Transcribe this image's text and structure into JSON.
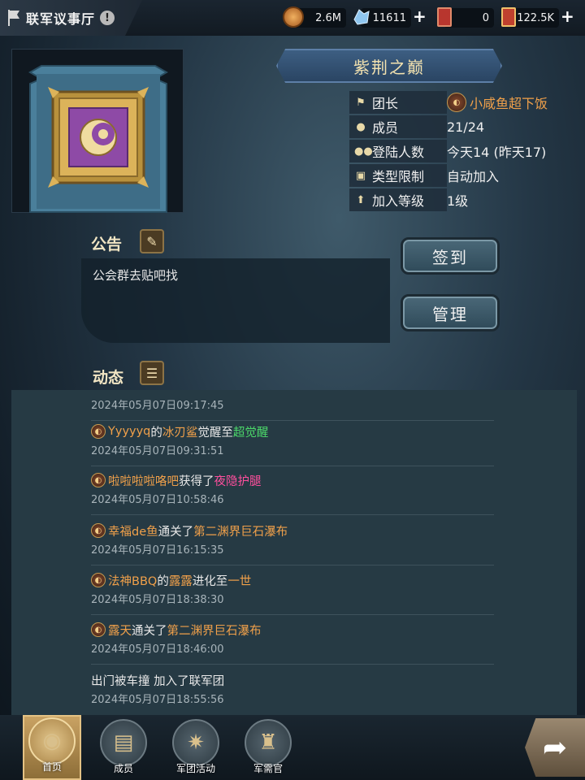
{
  "header": {
    "title": "联军议事厅",
    "info_icon": "!"
  },
  "resources": [
    {
      "name": "coin",
      "value": "2.6M",
      "color": "#d08a3a"
    },
    {
      "name": "crystal",
      "value": "11611",
      "color": "#8fc6ef"
    },
    {
      "name": "ticket-red",
      "value": "0",
      "color": "#b8362e"
    },
    {
      "name": "ticket-gold",
      "value": "122.5K",
      "color": "#c0402e"
    }
  ],
  "guild": {
    "name": "紫荆之巅",
    "rows": [
      {
        "label": "团长",
        "value": "小咸鱼超下饭",
        "icon": "flag-icon"
      },
      {
        "label": "成员",
        "value": "21/24",
        "icon": "person-icon"
      },
      {
        "label": "登陆人数",
        "value": "今天14 (昨天17)",
        "icon": "group-icon"
      },
      {
        "label": "类型限制",
        "value": "自动加入",
        "icon": "lock-icon"
      },
      {
        "label": "加入等级",
        "value": "1级",
        "icon": "up-arrow-icon"
      }
    ]
  },
  "notice": {
    "heading": "公告",
    "text": "公会群去贴吧找"
  },
  "buttons": {
    "checkin": "签到",
    "manage": "管理"
  },
  "feed": {
    "heading": "动态",
    "first_time": "2024年05月07日09:17:45",
    "items": [
      {
        "parts": [
          {
            "t": "Yyyyyq",
            "c": "o"
          },
          {
            "t": "的",
            "c": ""
          },
          {
            "t": "冰刃鲨",
            "c": "o"
          },
          {
            "t": "觉醒至",
            "c": ""
          },
          {
            "t": "超觉醒",
            "c": "g"
          }
        ],
        "time": "2024年05月07日09:31:51"
      },
      {
        "parts": [
          {
            "t": "啦啦啦啦咯吧",
            "c": "o"
          },
          {
            "t": "获得了",
            "c": ""
          },
          {
            "t": "夜隐护腿",
            "c": "p"
          }
        ],
        "time": "2024年05月07日10:58:46"
      },
      {
        "parts": [
          {
            "t": "幸福de鱼",
            "c": "o"
          },
          {
            "t": "通关了",
            "c": ""
          },
          {
            "t": "第二渊界巨石瀑布",
            "c": "o"
          }
        ],
        "time": "2024年05月07日16:15:35"
      },
      {
        "parts": [
          {
            "t": "法神BBQ",
            "c": "o"
          },
          {
            "t": "的",
            "c": ""
          },
          {
            "t": "露露",
            "c": "o"
          },
          {
            "t": "进化至",
            "c": ""
          },
          {
            "t": "一世",
            "c": "o"
          }
        ],
        "time": "2024年05月07日18:38:30"
      },
      {
        "parts": [
          {
            "t": "露天",
            "c": "o"
          },
          {
            "t": "通关了",
            "c": ""
          },
          {
            "t": "第二渊界巨石瀑布",
            "c": "o"
          }
        ],
        "time": "2024年05月07日18:46:00"
      },
      {
        "parts": [
          {
            "t": "出门被车撞 加入了联军团",
            "c": ""
          }
        ],
        "time": "2024年05月07日18:55:56"
      }
    ]
  },
  "nav": [
    {
      "label": "首页",
      "icon": "coins-icon"
    },
    {
      "label": "成员",
      "icon": "members-icon"
    },
    {
      "label": "军团活动",
      "icon": "star-badge-icon"
    },
    {
      "label": "军需官",
      "icon": "quartermaster-icon"
    }
  ]
}
